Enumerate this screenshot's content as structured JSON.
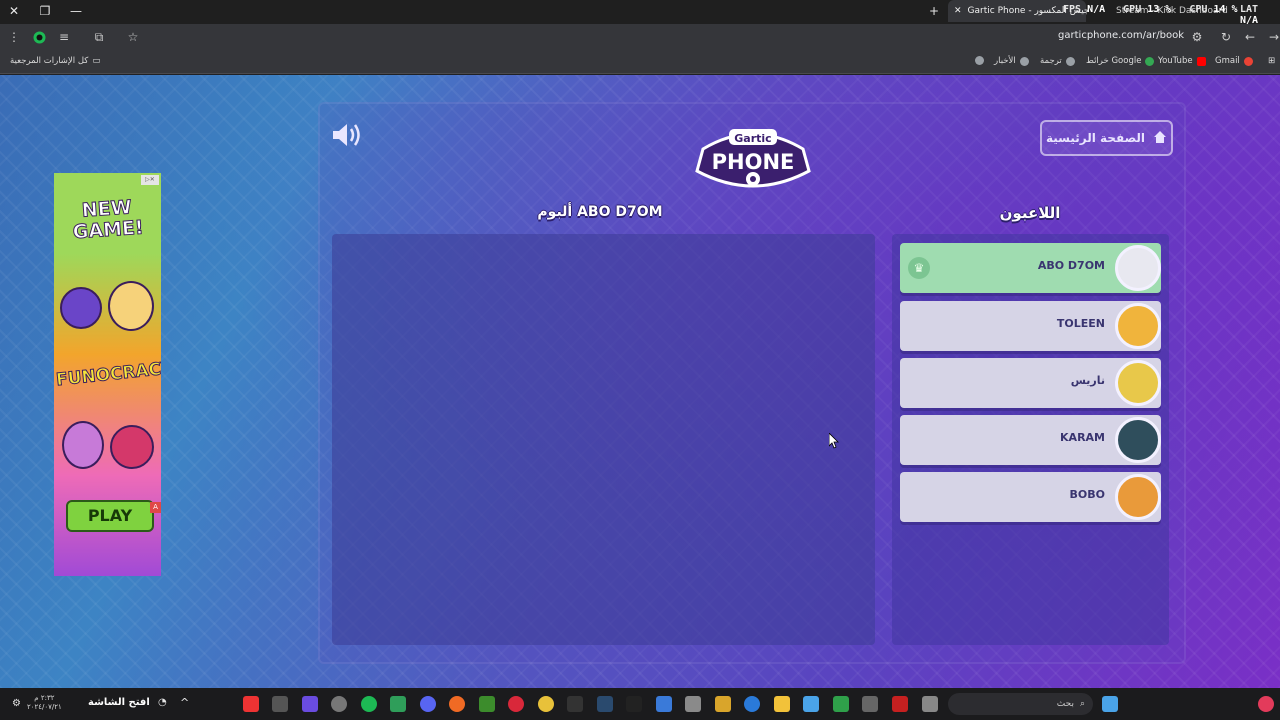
{
  "browser": {
    "active_tab_title": "Gartic Phone - جيش المكسور",
    "other_tab_title": "Stream - Kick Dashboard",
    "url": "garticphone.com/ar/book",
    "all_bookmarks_label": "كل الإشارات المرجعية",
    "bookmarks": [
      "Gmail",
      "YouTube",
      "خرائط Google",
      "ترجمة",
      "الأخبار"
    ]
  },
  "perf_overlay": {
    "fps_label": "FPS",
    "fps_value": "N/A",
    "gpu_label": "GPU",
    "gpu_value": "13 %",
    "cpu_label": "CPU",
    "cpu_value": "14 %",
    "lat_label": "LAT",
    "lat_value": "N/A"
  },
  "ad": {
    "headline": "NEW GAME!",
    "brand": "FUNOCRACY",
    "cta": "PLAY"
  },
  "game": {
    "logo_top": "Gartic",
    "logo_bottom": "PHONE",
    "home_button": "الصفحة الرئيسية",
    "album_title": "ألبوم ABO D7OM",
    "players_title": "اللاعبون",
    "players": [
      {
        "name": "ABO D7OM",
        "host": true,
        "avatar_color": "#e8e8f0"
      },
      {
        "name": "TOLEEN",
        "host": false,
        "avatar_color": "#f0b43c"
      },
      {
        "name": "ناريس",
        "host": false,
        "avatar_color": "#e8c84a"
      },
      {
        "name": "KARAM",
        "host": false,
        "avatar_color": "#2f4e5c"
      },
      {
        "name": "BOBO",
        "host": false,
        "avatar_color": "#e99a3a"
      }
    ]
  },
  "taskbar": {
    "start_text": "افتح الشاشة",
    "search_placeholder": "بحث",
    "clock_time": "٢:٣٢ م",
    "clock_date": "٢٠٢٤/٠٧/٢١"
  }
}
